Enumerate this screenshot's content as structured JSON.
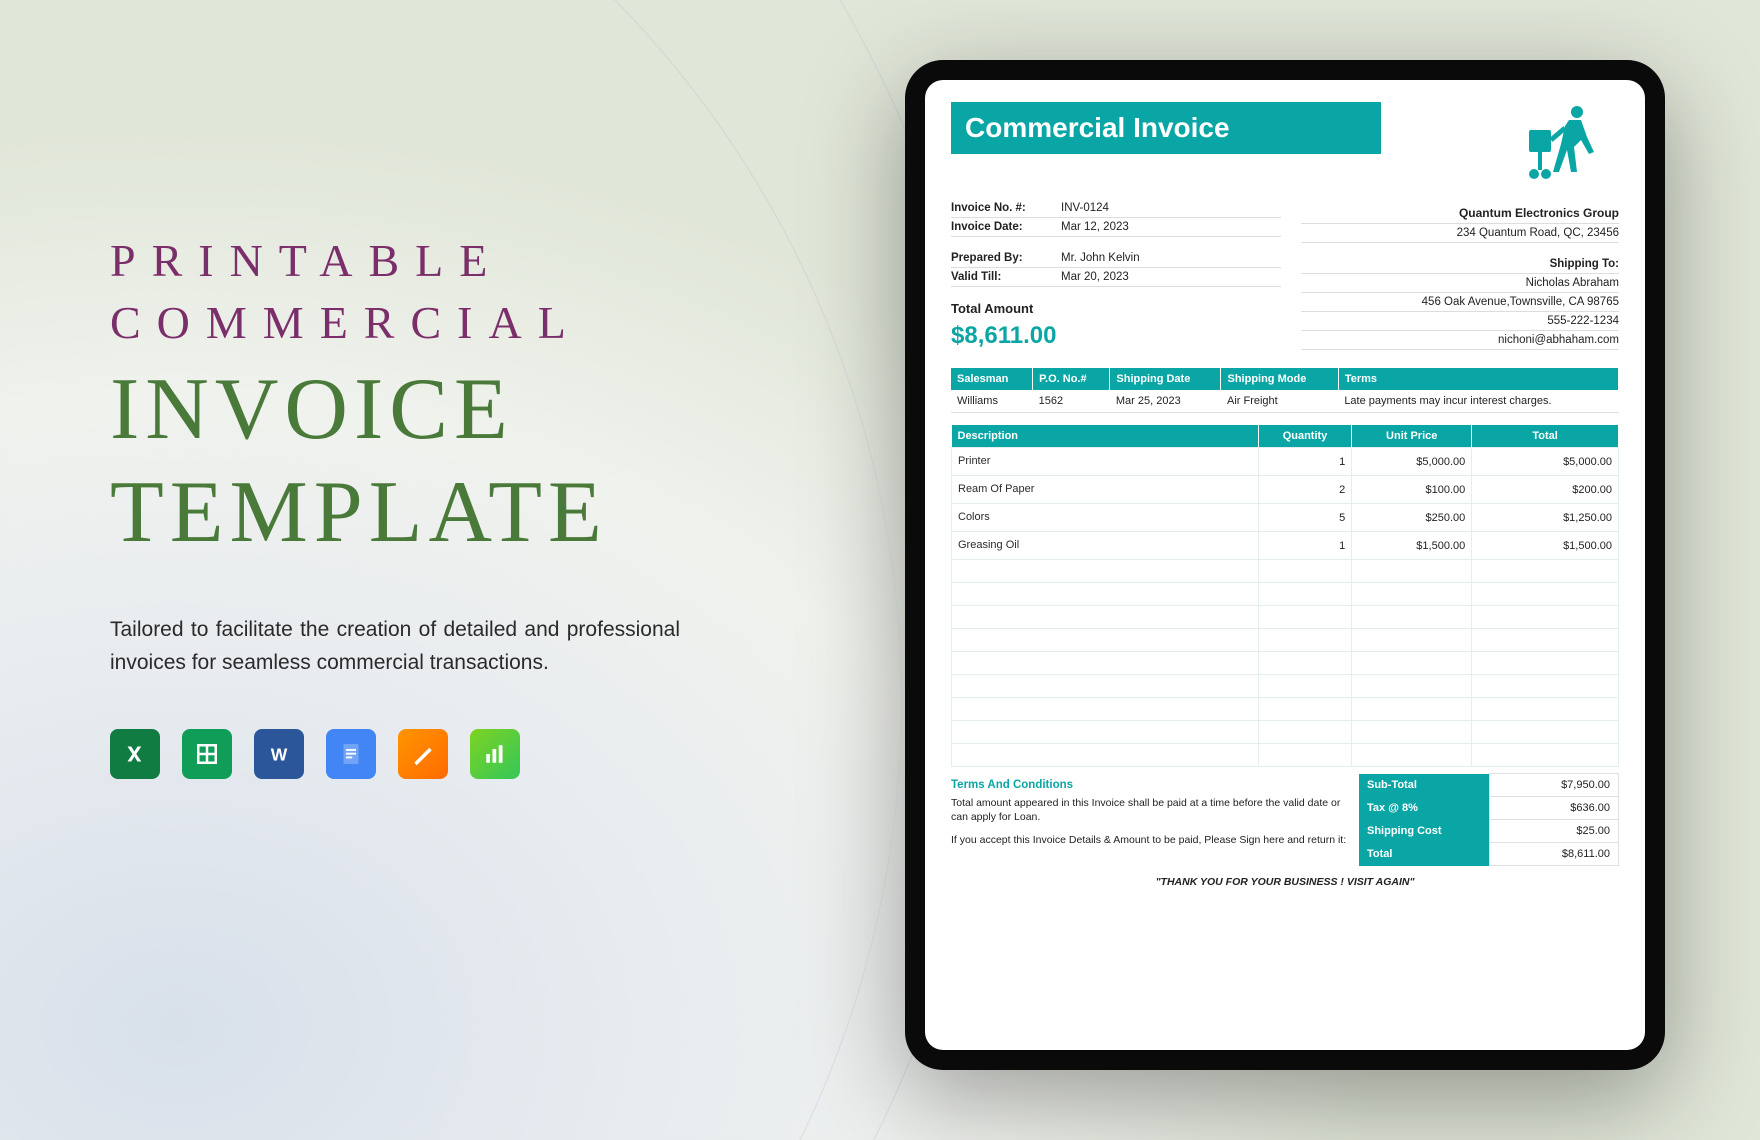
{
  "left": {
    "title_line1": "PRINTABLE",
    "title_line2": "COMMERCIAL",
    "title_line3": "INVOICE",
    "title_line4": "TEMPLATE",
    "description": "Tailored to facilitate the creation of detailed and professional invoices for seamless commercial transactions.",
    "apps": [
      "excel",
      "google-sheets",
      "word",
      "google-docs",
      "pages",
      "numbers"
    ]
  },
  "colors": {
    "teal": "#0aa6a6"
  },
  "invoice": {
    "title": "Commercial Invoice",
    "fields": {
      "invoice_no_label": "Invoice No. #:",
      "invoice_no": "INV-0124",
      "invoice_date_label": "Invoice Date:",
      "invoice_date": "Mar 12, 2023",
      "prepared_by_label": "Prepared By:",
      "prepared_by": "Mr. John Kelvin",
      "valid_till_label": "Valid Till:",
      "valid_till": "Mar 20, 2023"
    },
    "company": {
      "name": "Quantum Electronics Group",
      "address": "234 Quantum Road, QC, 23456"
    },
    "shipping": {
      "heading": "Shipping To:",
      "name": "Nicholas Abraham",
      "address": "456 Oak Avenue,Townsville, CA 98765",
      "phone": "555-222-1234",
      "email": "nichoni@abhaham.com"
    },
    "total_label": "Total Amount",
    "total_value": "$8,611.00",
    "info_headers": [
      "Salesman",
      "P.O. No.#",
      "Shipping Date",
      "Shipping Mode",
      "Terms"
    ],
    "info_row": [
      "Williams",
      "1562",
      "Mar 25, 2023",
      "Air Freight",
      "Late payments may incur interest charges."
    ],
    "item_headers": [
      "Description",
      "Quantity",
      "Unit Price",
      "Total"
    ],
    "items": [
      {
        "desc": "Printer",
        "qty": "1",
        "unit": "$5,000.00",
        "total": "$5,000.00"
      },
      {
        "desc": "Ream Of Paper",
        "qty": "2",
        "unit": "$100.00",
        "total": "$200.00"
      },
      {
        "desc": "Colors",
        "qty": "5",
        "unit": "$250.00",
        "total": "$1,250.00"
      },
      {
        "desc": "Greasing Oil",
        "qty": "1",
        "unit": "$1,500.00",
        "total": "$1,500.00"
      }
    ],
    "empty_rows": 9,
    "totals": [
      {
        "label": "Sub-Total",
        "value": "$7,950.00"
      },
      {
        "label": "Tax @ 8%",
        "value": "$636.00"
      },
      {
        "label": "Shipping Cost",
        "value": "$25.00"
      },
      {
        "label": "Total",
        "value": "$8,611.00"
      }
    ],
    "terms_heading": "Terms And Conditions",
    "terms_p1": "Total amount appeared in this Invoice shall be paid at a time before the valid date or can apply for Loan.",
    "terms_p2": "If you accept this Invoice Details & Amount to be paid, Please Sign here and return it:",
    "thanks": "\"THANK YOU FOR YOUR BUSINESS ! VISIT AGAIN\""
  }
}
